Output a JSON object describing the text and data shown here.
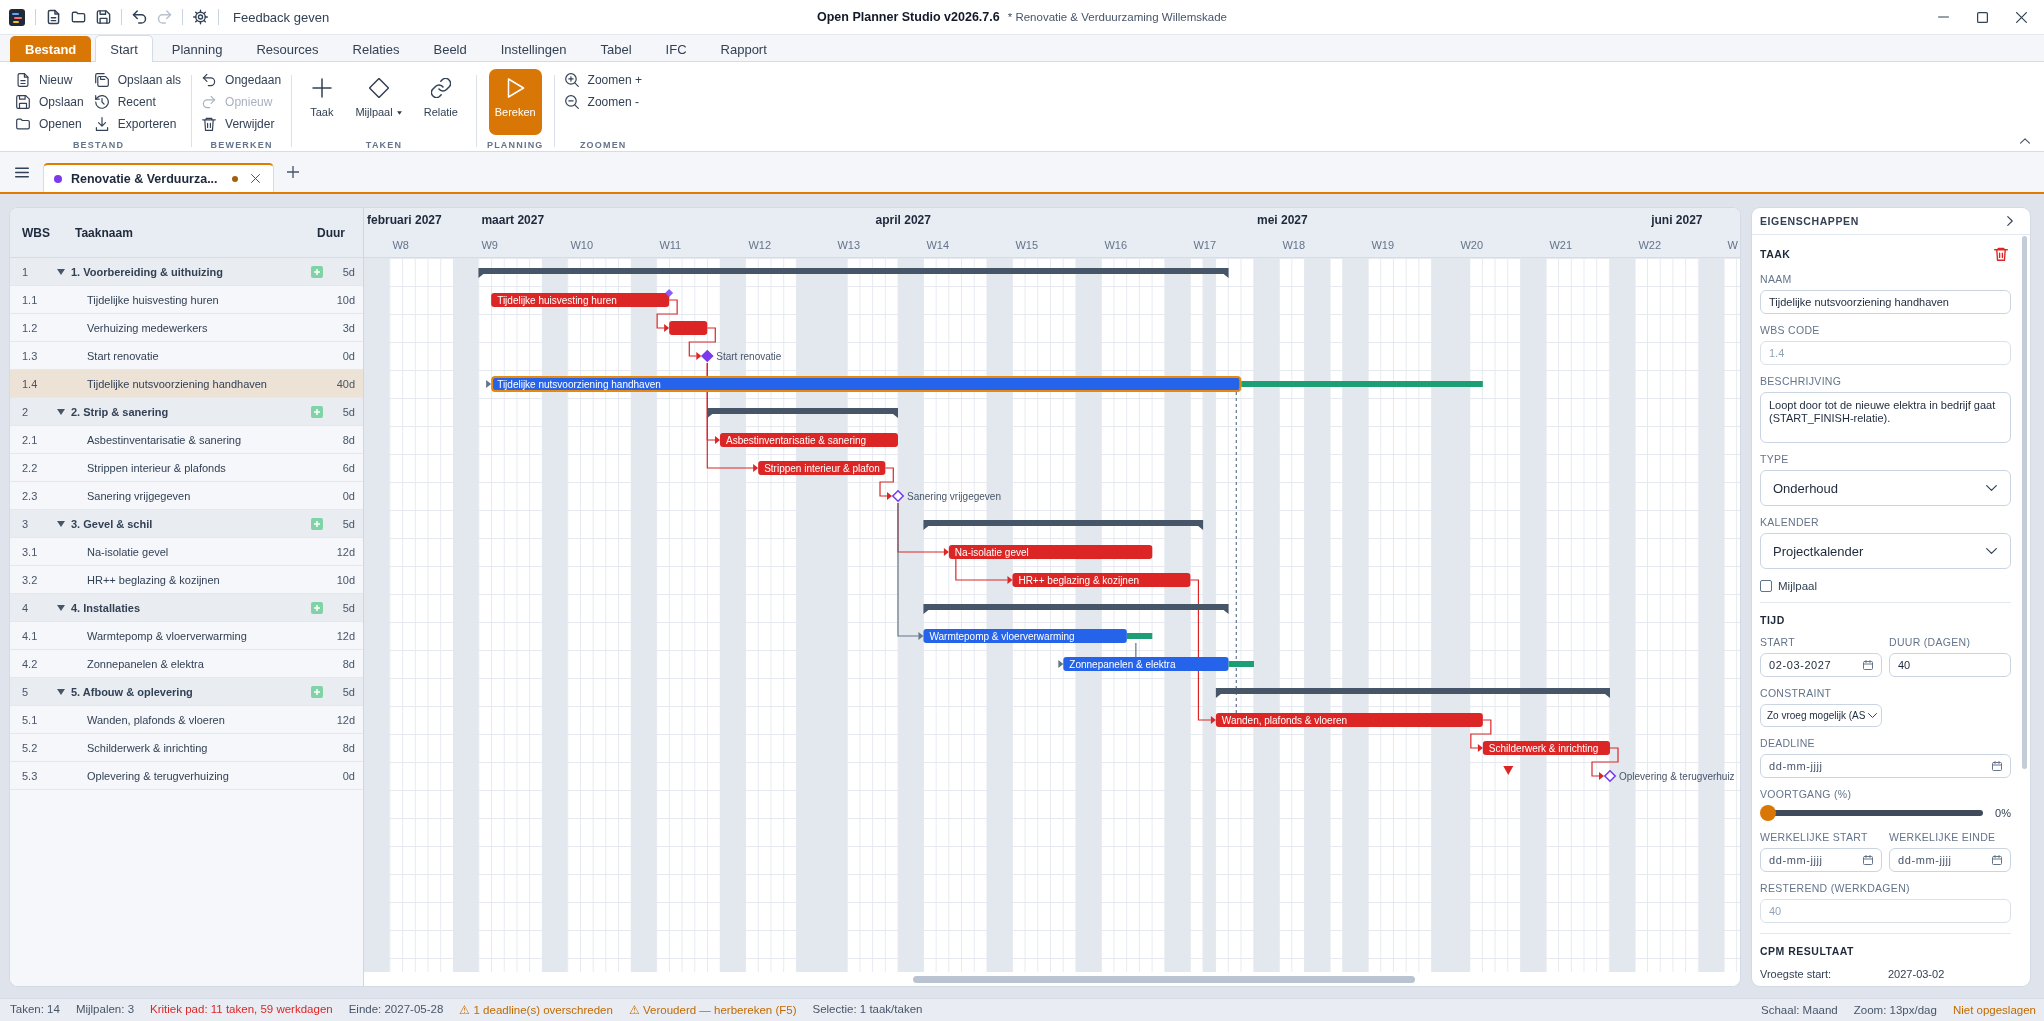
{
  "window": {
    "title": "Open Planner Studio v2026.7.6",
    "document": "* Renovatie & Verduurzaming Willemskade"
  },
  "quick_access": {
    "undo_disabled": false,
    "redo_disabled": true,
    "feedback": "Feedback geven"
  },
  "ribbon": {
    "tabs": [
      {
        "label": "Bestand",
        "kind": "file",
        "selected": false
      },
      {
        "label": "Start",
        "kind": "tab",
        "selected": true
      },
      {
        "label": "Planning",
        "kind": "tab",
        "selected": false
      },
      {
        "label": "Resources",
        "kind": "tab",
        "selected": false
      },
      {
        "label": "Relaties",
        "kind": "tab",
        "selected": false
      },
      {
        "label": "Beeld",
        "kind": "tab",
        "selected": false
      },
      {
        "label": "Instellingen",
        "kind": "tab",
        "selected": false
      },
      {
        "label": "Tabel",
        "kind": "tab",
        "selected": false
      },
      {
        "label": "IFC",
        "kind": "tab",
        "selected": false
      },
      {
        "label": "Rapport",
        "kind": "tab",
        "selected": false
      }
    ],
    "groups": [
      {
        "label": "BESTAND",
        "kind": "list",
        "items": [
          {
            "label": "Nieuw",
            "disabled": false
          },
          {
            "label": "Opslaan",
            "disabled": false
          },
          {
            "label": "Openen",
            "disabled": false
          },
          {
            "label": "Opslaan als",
            "disabled": false
          },
          {
            "label": "Recent",
            "disabled": false
          },
          {
            "label": "Exporteren",
            "disabled": false
          }
        ]
      },
      {
        "label": "BEWERKEN",
        "kind": "list",
        "items": [
          {
            "label": "Ongedaan",
            "disabled": false
          },
          {
            "label": "Opnieuw",
            "disabled": true
          },
          {
            "label": "Verwijder",
            "disabled": false
          }
        ]
      },
      {
        "label": "TAKEN",
        "kind": "large",
        "items": [
          {
            "label": "Taak",
            "menu": false
          },
          {
            "label": "Mijlpaal",
            "menu": true
          },
          {
            "label": "Relatie",
            "menu": false
          }
        ]
      },
      {
        "label": "PLANNING",
        "kind": "primary",
        "items": [
          {
            "label": "Bereken"
          }
        ]
      },
      {
        "label": "ZOOMEN",
        "kind": "list",
        "items": [
          {
            "label": "Zoomen +",
            "disabled": false
          },
          {
            "label": "Zoomen -",
            "disabled": false
          }
        ]
      }
    ]
  },
  "document_tabs": [
    {
      "label": "Renovatie & Verduurza...",
      "color": "#7c3aed",
      "unsaved": true,
      "selected": true
    }
  ],
  "table": {
    "columns": [
      "WBS",
      "Taaknaam",
      "Duur"
    ],
    "rows": [
      {
        "wbs": "1",
        "name": "1. Voorbereiding & uithuizing",
        "duration": "5d",
        "expanded": true,
        "selected": false,
        "children": [
          {
            "wbs": "1.1",
            "name": "Tijdelijke huisvesting huren",
            "duration": "10d",
            "selected": false
          },
          {
            "wbs": "1.2",
            "name": "Verhuizing medewerkers",
            "duration": "3d",
            "selected": false
          },
          {
            "wbs": "1.3",
            "name": "Start renovatie",
            "duration": "0d",
            "selected": false
          },
          {
            "wbs": "1.4",
            "name": "Tijdelijke nutsvoorziening handhaven",
            "duration": "40d",
            "selected": true
          }
        ]
      },
      {
        "wbs": "2",
        "name": "2. Strip & sanering",
        "duration": "5d",
        "expanded": true,
        "selected": false,
        "children": [
          {
            "wbs": "2.1",
            "name": "Asbestinventarisatie & sanering",
            "duration": "8d",
            "selected": false
          },
          {
            "wbs": "2.2",
            "name": "Strippen interieur & plafonds",
            "duration": "6d",
            "selected": false
          },
          {
            "wbs": "2.3",
            "name": "Sanering vrijgegeven",
            "duration": "0d",
            "selected": false
          }
        ]
      },
      {
        "wbs": "3",
        "name": "3. Gevel & schil",
        "duration": "5d",
        "expanded": true,
        "selected": false,
        "children": [
          {
            "wbs": "3.1",
            "name": "Na-isolatie gevel",
            "duration": "12d",
            "selected": false
          },
          {
            "wbs": "3.2",
            "name": "HR++ beglazing & kozijnen",
            "duration": "10d",
            "selected": false
          }
        ]
      },
      {
        "wbs": "4",
        "name": "4. Installaties",
        "duration": "5d",
        "expanded": true,
        "selected": false,
        "children": [
          {
            "wbs": "4.1",
            "name": "Warmtepomp & vloerverwarming",
            "duration": "12d",
            "selected": false
          },
          {
            "wbs": "4.2",
            "name": "Zonnepanelen & elektra",
            "duration": "8d",
            "selected": false
          }
        ]
      },
      {
        "wbs": "5",
        "name": "5. Afbouw & oplevering",
        "duration": "5d",
        "expanded": true,
        "selected": false,
        "children": [
          {
            "wbs": "5.1",
            "name": "Wanden, plafonds & vloeren",
            "duration": "12d",
            "selected": false
          },
          {
            "wbs": "5.2",
            "name": "Schilderwerk & inrichting",
            "duration": "8d",
            "selected": false
          },
          {
            "wbs": "5.3",
            "name": "Oplevering & terugverhuizing",
            "duration": "0d",
            "selected": false
          }
        ]
      }
    ]
  },
  "gantt": {
    "months": [
      "februari 2027",
      "maart 2027",
      "april 2027",
      "mei 2027",
      "juni 2027"
    ],
    "weeks": [
      "W8",
      "W9",
      "W10",
      "W11",
      "W12",
      "W13",
      "W14",
      "W15",
      "W16",
      "W17",
      "W18",
      "W19",
      "W20",
      "W21",
      "W22",
      "W"
    ],
    "bars": [
      {
        "kind": "summary",
        "selected": false
      },
      {
        "kind": "task",
        "label": "Tijdelijke huisvesting huren",
        "critical": true,
        "selected": false,
        "constraint_marker": true
      },
      {
        "kind": "task",
        "critical": true,
        "selected": false
      },
      {
        "kind": "milestone",
        "label": "Start renovatie",
        "critical": true,
        "filled": true,
        "selected": false
      },
      {
        "kind": "task",
        "label": "Tijdelijke nutsvoorziening handhaven",
        "critical": false,
        "selected": true,
        "float": true
      },
      {
        "kind": "summary",
        "selected": false
      },
      {
        "kind": "task",
        "label": "Asbestinventarisatie & sanering",
        "critical": true,
        "selected": false
      },
      {
        "kind": "task",
        "label": "Strippen interieur & plafon",
        "critical": true,
        "selected": false
      },
      {
        "kind": "milestone",
        "label": "Sanering vrijgegeven",
        "critical": true,
        "filled": false,
        "selected": false
      },
      {
        "kind": "summary",
        "selected": false
      },
      {
        "kind": "task",
        "label": "Na-isolatie gevel",
        "critical": true,
        "selected": false
      },
      {
        "kind": "task",
        "label": "HR++ beglazing & kozijnen",
        "critical": true,
        "selected": false
      },
      {
        "kind": "summary",
        "selected": false
      },
      {
        "kind": "task",
        "label": "Warmtepomp & vloerverwarming",
        "critical": false,
        "selected": false,
        "float": true
      },
      {
        "kind": "task",
        "label": "Zonnepanelen & elektra",
        "critical": false,
        "selected": false,
        "float": true
      },
      {
        "kind": "summary",
        "selected": false
      },
      {
        "kind": "task",
        "label": "Wanden, plafonds & vloeren",
        "critical": true,
        "selected": false
      },
      {
        "kind": "task",
        "label": "Schilderwerk & inrichting",
        "critical": true,
        "selected": false,
        "deadline_missed": true
      },
      {
        "kind": "milestone",
        "label": "Oplevering & terugverhuiz",
        "critical": true,
        "filled": false,
        "selected": false
      }
    ]
  },
  "properties": {
    "header": "EIGENSCHAPPEN",
    "sections": [
      {
        "title": "TAAK",
        "deletable": true,
        "rows": [
          [
            {
              "kind": "text",
              "label": "NAAM",
              "value": "Tijdelijke nutsvoorziening handhaven",
              "disabled": false
            }
          ],
          [
            {
              "kind": "text",
              "label": "WBS CODE",
              "value": "1.4",
              "disabled": true
            }
          ],
          [
            {
              "kind": "textarea",
              "label": "BESCHRIJVING",
              "value": "Loopt door tot de nieuwe elektra in bedrijf gaat (START_FINISH-relatie)."
            }
          ],
          [
            {
              "kind": "dropdown",
              "label": "TYPE",
              "value": "Onderhoud"
            }
          ],
          [
            {
              "kind": "dropdown",
              "label": "KALENDER",
              "value": "Projectkalender"
            }
          ],
          [
            {
              "kind": "checkbox",
              "label": "Mijlpaal",
              "checked": false
            }
          ]
        ]
      },
      {
        "title": "TIJD",
        "rows": [
          [
            {
              "kind": "date",
              "label": "START",
              "value": "02-03-2027"
            },
            {
              "kind": "text",
              "label": "DUUR (DAGEN)",
              "value": "40",
              "disabled": false
            }
          ],
          [
            {
              "kind": "select",
              "label": "CONSTRAINT",
              "value": "Zo vroeg mogelijk (AS"
            }
          ],
          [
            {
              "kind": "date",
              "label": "DEADLINE",
              "placeholder": "dd-mm-jjjj"
            }
          ],
          [
            {
              "kind": "slider",
              "label": "VOORTGANG (%)",
              "level": 0,
              "reading": "0%"
            }
          ],
          [
            {
              "kind": "date",
              "label": "WERKELIJKE START",
              "placeholder": "dd-mm-jjjj"
            },
            {
              "kind": "date",
              "label": "WERKELIJKE EINDE",
              "placeholder": "dd-mm-jjjj"
            }
          ],
          [
            {
              "kind": "text",
              "label": "RESTEREND (WERKDAGEN)",
              "value": "40",
              "disabled": true
            }
          ]
        ]
      },
      {
        "title": "CPM RESULTAAT",
        "rows": [
          [
            {
              "kind": "readout",
              "label": "Vroegste start:",
              "value": "2027-03-02"
            }
          ]
        ]
      }
    ]
  },
  "status_bar": {
    "left": [
      {
        "text": "Taken: 14",
        "color": "#475569"
      },
      {
        "text": "Mijlpalen: 3",
        "color": "#475569"
      },
      {
        "text": "Kritiek pad: 11 taken, 59 werkdagen",
        "color": "#dc2626"
      },
      {
        "text": "Einde: 2027-05-28",
        "color": "#475569"
      },
      {
        "text": "⚠ 1 deadline(s) overschreden",
        "color": "#c26a00"
      },
      {
        "text": "⚠ Verouderd — herbereken (F5)",
        "color": "#c26a00"
      },
      {
        "text": "Selectie: 1 taak/taken",
        "color": "#475569"
      }
    ],
    "right": [
      {
        "text": "Schaal: Maand",
        "color": "#475569"
      },
      {
        "text": "Zoom: 13px/dag",
        "color": "#475569"
      },
      {
        "text": "Niet opgeslagen",
        "color": "#c26a00"
      }
    ]
  }
}
